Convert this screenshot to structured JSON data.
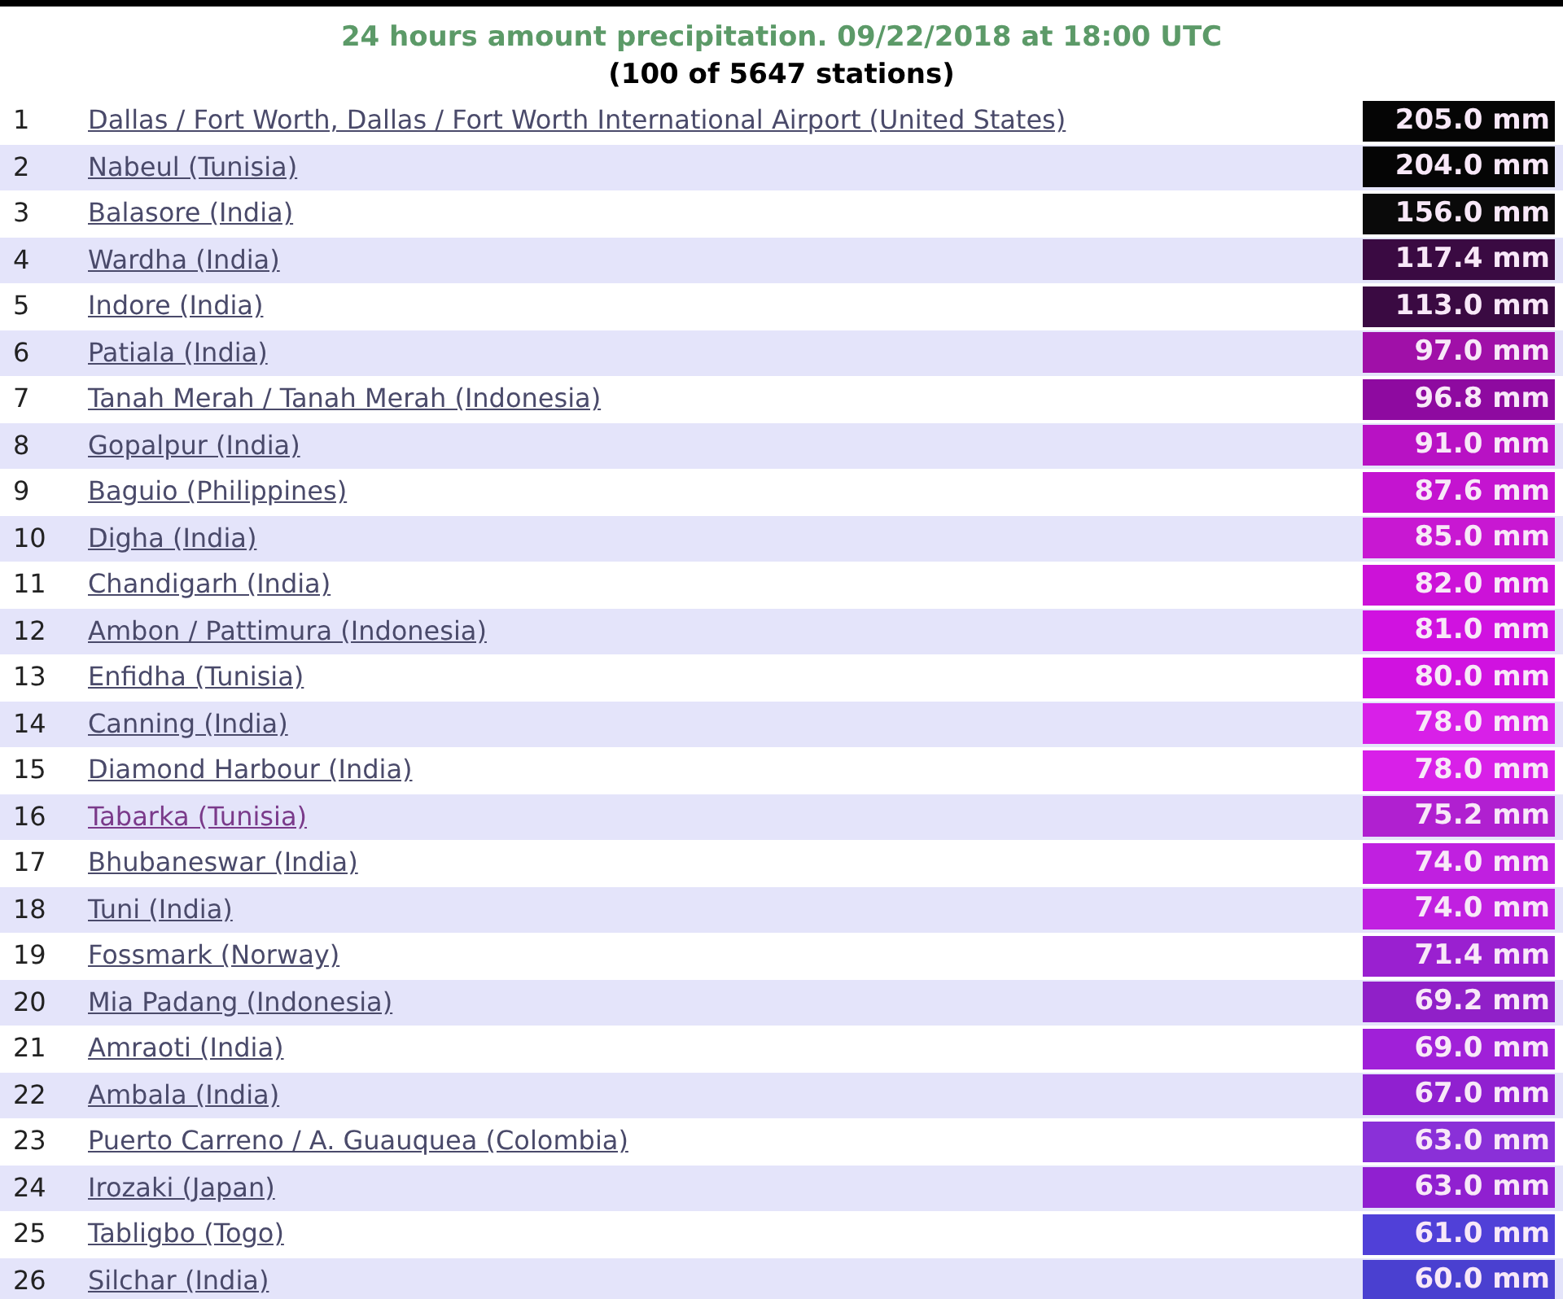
{
  "title": "24 hours amount precipitation. 09/22/2018 at 18:00 UTC",
  "subtitle": "(100 of 5647 stations)",
  "rows": [
    {
      "rank": "1",
      "station": "Dallas / Fort Worth, Dallas / Fort Worth International Airport (United States)",
      "amount": "205.0 mm",
      "color": "#050505",
      "visited": false
    },
    {
      "rank": "2",
      "station": "Nabeul (Tunisia)",
      "amount": "204.0 mm",
      "color": "#050505",
      "visited": false
    },
    {
      "rank": "3",
      "station": "Balasore (India)",
      "amount": "156.0 mm",
      "color": "#0a0a0a",
      "visited": false
    },
    {
      "rank": "4",
      "station": "Wardha (India)",
      "amount": "117.4 mm",
      "color": "#3a0a42",
      "visited": false
    },
    {
      "rank": "5",
      "station": "Indore (India)",
      "amount": "113.0 mm",
      "color": "#3a0a42",
      "visited": false
    },
    {
      "rank": "6",
      "station": "Patiala (India)",
      "amount": "97.0 mm",
      "color": "#a010a8",
      "visited": false
    },
    {
      "rank": "7",
      "station": "Tanah Merah / Tanah Merah (Indonesia)",
      "amount": "96.8 mm",
      "color": "#8e0aa0",
      "visited": false
    },
    {
      "rank": "8",
      "station": "Gopalpur (India)",
      "amount": "91.0 mm",
      "color": "#b812c4",
      "visited": false
    },
    {
      "rank": "9",
      "station": "Baguio (Philippines)",
      "amount": "87.6 mm",
      "color": "#c414d0",
      "visited": false
    },
    {
      "rank": "10",
      "station": "Digha (India)",
      "amount": "85.0 mm",
      "color": "#c818d2",
      "visited": false
    },
    {
      "rank": "11",
      "station": "Chandigarh (India)",
      "amount": "82.0 mm",
      "color": "#cc12d8",
      "visited": false
    },
    {
      "rank": "12",
      "station": "Ambon / Pattimura (Indonesia)",
      "amount": "81.0 mm",
      "color": "#d012e0",
      "visited": false
    },
    {
      "rank": "13",
      "station": "Enfidha (Tunisia)",
      "amount": "80.0 mm",
      "color": "#d012e0",
      "visited": false
    },
    {
      "rank": "14",
      "station": "Canning (India)",
      "amount": "78.0 mm",
      "color": "#d820e8",
      "visited": false
    },
    {
      "rank": "15",
      "station": "Diamond Harbour (India)",
      "amount": "78.0 mm",
      "color": "#d820e8",
      "visited": false
    },
    {
      "rank": "16",
      "station": "Tabarka (Tunisia)",
      "amount": "75.2 mm",
      "color": "#b020d0",
      "visited": true
    },
    {
      "rank": "17",
      "station": "Bhubaneswar (India)",
      "amount": "74.0 mm",
      "color": "#c020e0",
      "visited": false
    },
    {
      "rank": "18",
      "station": "Tuni (India)",
      "amount": "74.0 mm",
      "color": "#c020e0",
      "visited": false
    },
    {
      "rank": "19",
      "station": "Fossmark (Norway)",
      "amount": "71.4 mm",
      "color": "#9a20d0",
      "visited": false
    },
    {
      "rank": "20",
      "station": "Mia Padang (Indonesia)",
      "amount": "69.2 mm",
      "color": "#9020c8",
      "visited": false
    },
    {
      "rank": "21",
      "station": "Amraoti (India)",
      "amount": "69.0 mm",
      "color": "#a020d8",
      "visited": false
    },
    {
      "rank": "22",
      "station": "Ambala (India)",
      "amount": "67.0 mm",
      "color": "#9020d0",
      "visited": false
    },
    {
      "rank": "23",
      "station": "Puerto Carreno / A. Guauquea (Colombia)",
      "amount": "63.0 mm",
      "color": "#8a30d8",
      "visited": false
    },
    {
      "rank": "24",
      "station": "Irozaki (Japan)",
      "amount": "63.0 mm",
      "color": "#9020d0",
      "visited": false
    },
    {
      "rank": "25",
      "station": "Tabligbo (Togo)",
      "amount": "61.0 mm",
      "color": "#5040d8",
      "visited": false
    },
    {
      "rank": "26",
      "station": "Silchar (India)",
      "amount": "60.0 mm",
      "color": "#4a40d0",
      "visited": false
    }
  ]
}
